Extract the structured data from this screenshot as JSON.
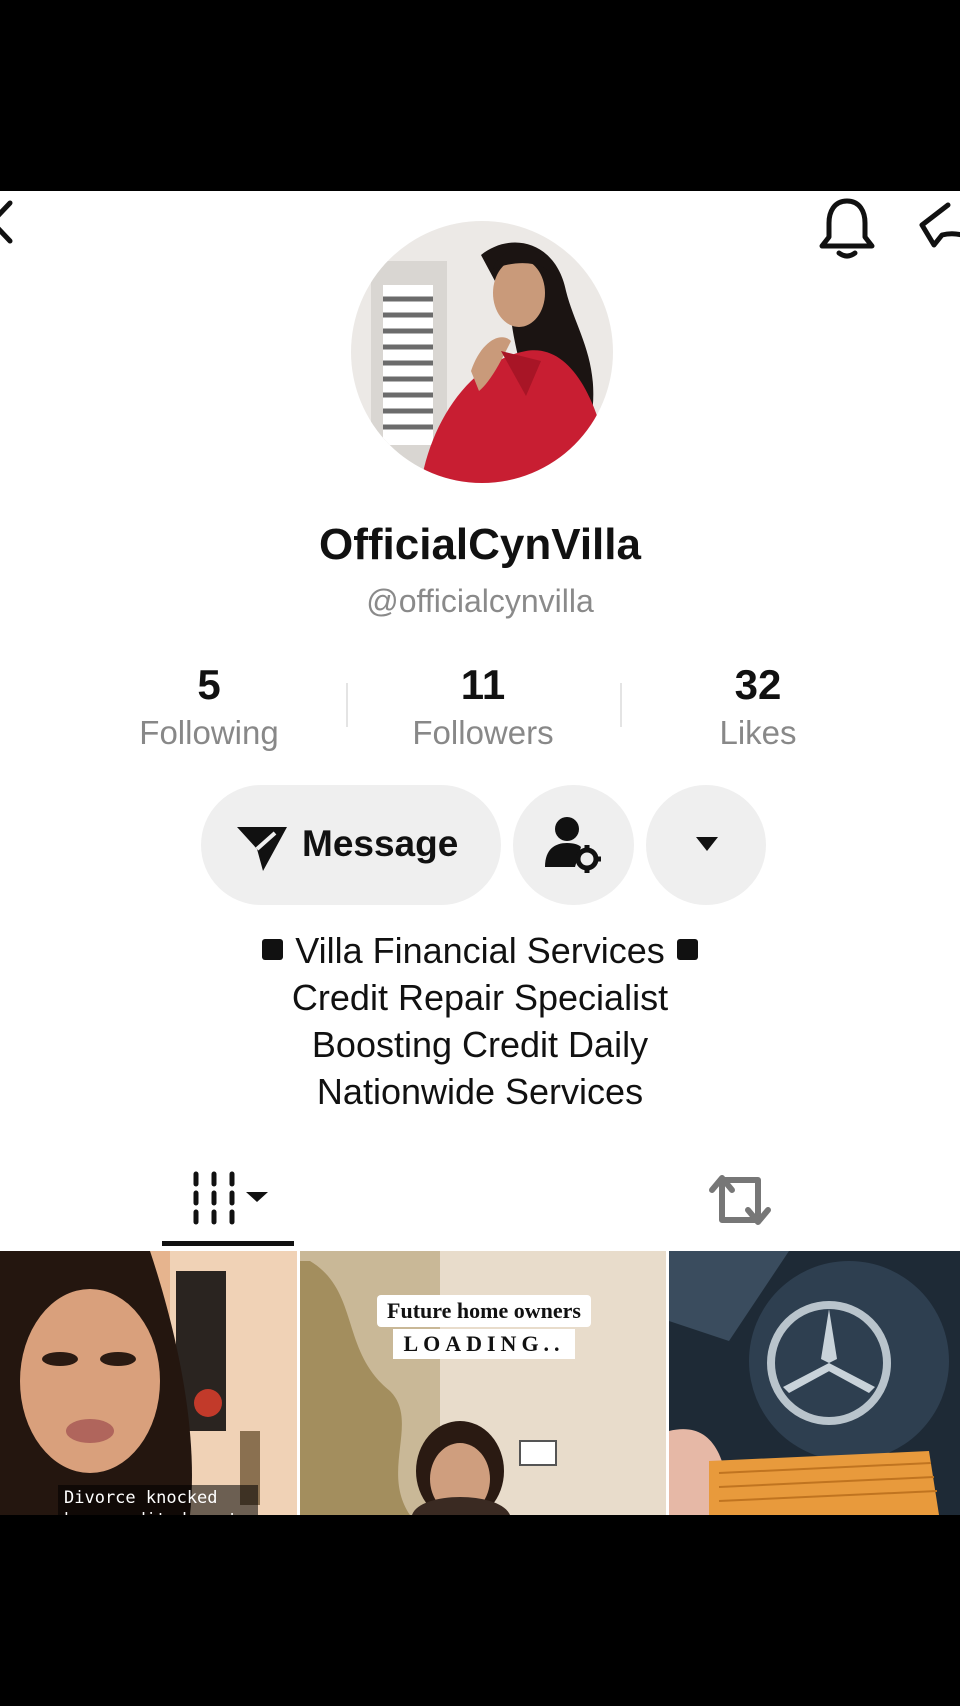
{
  "profile": {
    "display_name": "OfficialCynVilla",
    "handle": "@officialcynvilla"
  },
  "stats": [
    {
      "value": "5",
      "label": "Following"
    },
    {
      "value": "11",
      "label": "Followers"
    },
    {
      "value": "32",
      "label": "Likes"
    }
  ],
  "actions": {
    "message_label": "Message"
  },
  "bio": {
    "line1": "Villa Financial Services",
    "line2": "Credit Repair Specialist",
    "line3": "Boosting Credit Daily",
    "line4": "Nationwide Services"
  },
  "videos": [
    {
      "caption": "Divorce knocked her credit down to the"
    },
    {
      "caption_line1": "Future home owners",
      "caption_line2": "LOADING.."
    },
    {
      "caption": ""
    }
  ],
  "icons": {
    "back": "chevron-left-icon",
    "notifications": "bell-icon",
    "share": "share-icon",
    "message": "send-icon",
    "profile_settings": "user-gear-icon",
    "more": "caret-down-icon",
    "videos_tab": "grid-icon",
    "reposts_tab": "repost-icon"
  }
}
